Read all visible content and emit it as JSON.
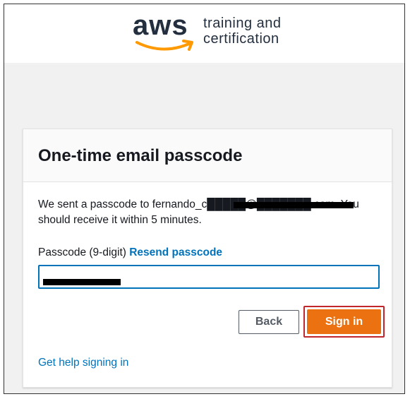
{
  "header": {
    "logo_text": "aws",
    "logo_line1": "training and",
    "logo_line2": "certification"
  },
  "card": {
    "title": "One-time email passcode",
    "message": "We sent a passcode to fernando_c█████@███████.com. You should receive it within 5 minutes.",
    "passcode_label": "Passcode (9-digit)",
    "resend_link": "Resend passcode",
    "passcode_value": "",
    "back_label": "Back",
    "signin_label": "Sign in",
    "help_link": "Get help signing in"
  },
  "colors": {
    "accent": "#ec7211",
    "link": "#0073bb",
    "focus_outline": "#c0262c"
  }
}
